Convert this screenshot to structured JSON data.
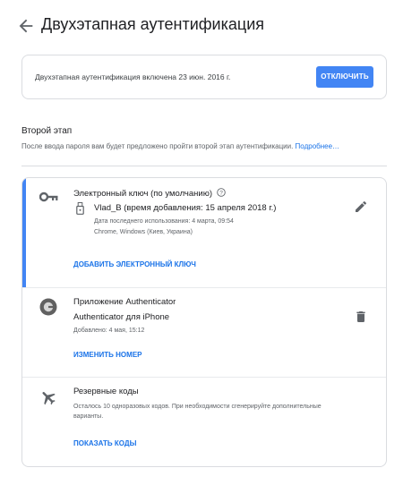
{
  "header": {
    "title": "Двухэтапная аутентификация"
  },
  "status": {
    "text": "Двухэтапная аутентификация включена 23 июн. 2016 г.",
    "disable_label": "ОТКЛЮЧИТЬ"
  },
  "second_step": {
    "title": "Второй этап",
    "description": "После ввода пароля вам будет предложено пройти второй этап аутентификации.",
    "more_link": "Подробнее…"
  },
  "methods": {
    "security_key": {
      "title": "Электронный ключ (по умолчанию)",
      "key_name": "Vlad_B (время добавления: 15 апреля 2018 г.)",
      "last_used": "Дата последнего использования: 4 марта, 09:54",
      "device": "Chrome, Windows (Киев, Украина)",
      "add_label": "ДОБАВИТЬ ЭЛЕКТРОННЫЙ КЛЮЧ",
      "accent_color": "#4285f4"
    },
    "authenticator": {
      "title": "Приложение Authenticator",
      "app": "Authenticator для iPhone",
      "added": "Добавлено: 4 мая, 15:12",
      "change_label": "ИЗМЕНИТЬ НОМЕР"
    },
    "backup_codes": {
      "title": "Резервные коды",
      "desc_line1": "Осталось 10 одноразовых кодов. При необходимости сгенерируйте дополнительные",
      "desc_line2": "варианты.",
      "show_label": "ПОКАЗАТЬ КОДЫ"
    }
  }
}
